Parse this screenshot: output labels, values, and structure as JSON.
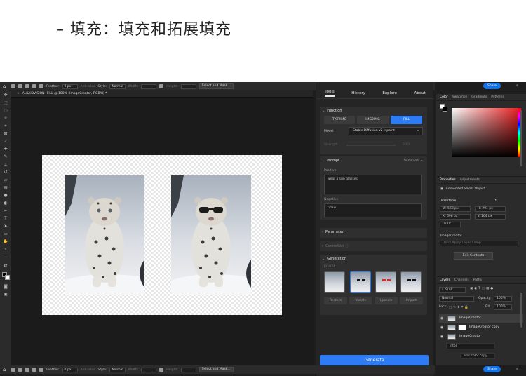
{
  "heading": "– 填充：填充和拓展填充",
  "optionbar": {
    "feather_label": "Feather:",
    "feather_value": "0 px",
    "antialias_label": "Anti-alias",
    "style_label": "Style:",
    "style_value": "Normal",
    "width_label": "Width:",
    "height_label": "Height:",
    "select_mask": "Select and Mask..."
  },
  "share_label": "Share",
  "document_tab": "ALKAIDVISION--FILL @ 100% (ImageCreator, RGB/8) *",
  "plugin": {
    "tabs": [
      "Tools",
      "History",
      "Explore",
      "About"
    ],
    "function_title": "Function",
    "functions": [
      "TXT2IMG",
      "IMG2IMG",
      "FILL"
    ],
    "model_label": "Model",
    "model_value": "Stable Diffusion v2-inpaint",
    "strength_label": "Strength",
    "strength_value": "0.80",
    "prompt_title": "Prompt",
    "advanced_label": "Advanced",
    "positive_label": "Positive",
    "positive_value": "wear a sun glasses",
    "negative_label": "Negative",
    "negative_value": "nflaw",
    "parameter_title": "Parameter",
    "controlnet_title": "ControlNet",
    "generation_title": "Generation",
    "generation_count": "6/1024",
    "actions": [
      "Restore",
      "Variate",
      "Upscale",
      "Import"
    ],
    "generate_label": "Generate"
  },
  "color_panel": {
    "tabs": [
      "Color",
      "Swatches",
      "Gradients",
      "Patterns"
    ]
  },
  "properties_panel": {
    "tabs": [
      "Properties",
      "Adjustments"
    ],
    "type_label": "Embedded Smart Object",
    "transform_title": "Transform",
    "w_value": "W: 563 px",
    "h_value": "H: 291 px",
    "x_value": "X: 696 px",
    "y_value": "Y: 164 px",
    "angle_value": "0.00°",
    "smart_name": "ImageCreator",
    "layer_comp": "Don't Apply Layer Comp",
    "edit_contents": "Edit Contents"
  },
  "layers_panel": {
    "tabs": [
      "Layers",
      "Channels",
      "Paths"
    ],
    "kind_label": "Kind",
    "blend_mode": "Normal",
    "opacity_label": "Opacity:",
    "opacity_value": "100%",
    "lock_label": "Lock:",
    "fill_label": "Fill:",
    "fill_value": "100%",
    "layers": [
      "ImageCreator",
      "ImageCreator copy",
      "ImageCreator"
    ],
    "tooltip_1": "intor",
    "tooltip_2": "ator color copy"
  }
}
